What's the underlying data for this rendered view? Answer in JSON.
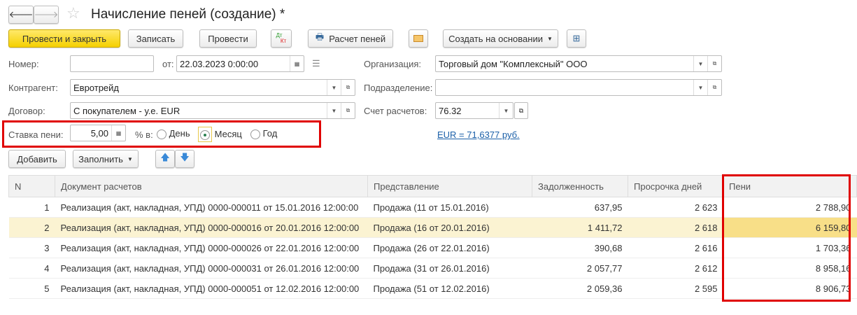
{
  "title": "Начисление пеней (создание) *",
  "toolbar": {
    "post_close": "Провести и закрыть",
    "save": "Записать",
    "post": "Провести",
    "dtkt_dt": "Дт",
    "dtkt_kt": "Кт",
    "calc": "Расчет пеней",
    "create_based": "Создать на основании"
  },
  "form": {
    "number_label": "Номер:",
    "number_value": "",
    "date_label": "от:",
    "date_value": "22.03.2023  0:00:00",
    "org_label": "Организация:",
    "org_value": "Торговый дом \"Комплексный\" ООО",
    "contractor_label": "Контрагент:",
    "contractor_value": "Евротрейд",
    "division_label": "Подразделение:",
    "division_value": "",
    "contract_label": "Договор:",
    "contract_value": "С покупателем - у.е. EUR",
    "account_label": "Счет расчетов:",
    "account_value": "76.32",
    "rate_label": "Ставка пени:",
    "rate_value": "5,00",
    "per_label": "% в:",
    "period_options": [
      "День",
      "Месяц",
      "Год"
    ],
    "period_selected": "Месяц",
    "currency_link": "EUR = 71,6377 руб."
  },
  "table_toolbar": {
    "add": "Добавить",
    "fill": "Заполнить"
  },
  "table": {
    "headers": [
      "N",
      "Документ расчетов",
      "Представление",
      "Задолженность",
      "Просрочка дней",
      "Пени"
    ],
    "rows": [
      [
        "1",
        "Реализация (акт, накладная, УПД) 0000-000011 от 15.01.2016 12:00:00",
        "Продажа (11 от 15.01.2016)",
        "637,95",
        "2 623",
        "2 788,90"
      ],
      [
        "2",
        "Реализация (акт, накладная, УПД) 0000-000016 от 20.01.2016 12:00:00",
        "Продажа (16 от 20.01.2016)",
        "1 411,72",
        "2 618",
        "6 159,80"
      ],
      [
        "3",
        "Реализация (акт, накладная, УПД) 0000-000026 от 22.01.2016 12:00:00",
        "Продажа (26 от 22.01.2016)",
        "390,68",
        "2 616",
        "1 703,36"
      ],
      [
        "4",
        "Реализация (акт, накладная, УПД) 0000-000031 от 26.01.2016 12:00:00",
        "Продажа (31 от 26.01.2016)",
        "2 057,77",
        "2 612",
        "8 958,16"
      ],
      [
        "5",
        "Реализация (акт, накладная, УПД) 0000-000051 от 12.02.2016 12:00:00",
        "Продажа (51 от 12.02.2016)",
        "2 059,36",
        "2 595",
        "8 906,73"
      ]
    ],
    "selected_row": 2
  }
}
